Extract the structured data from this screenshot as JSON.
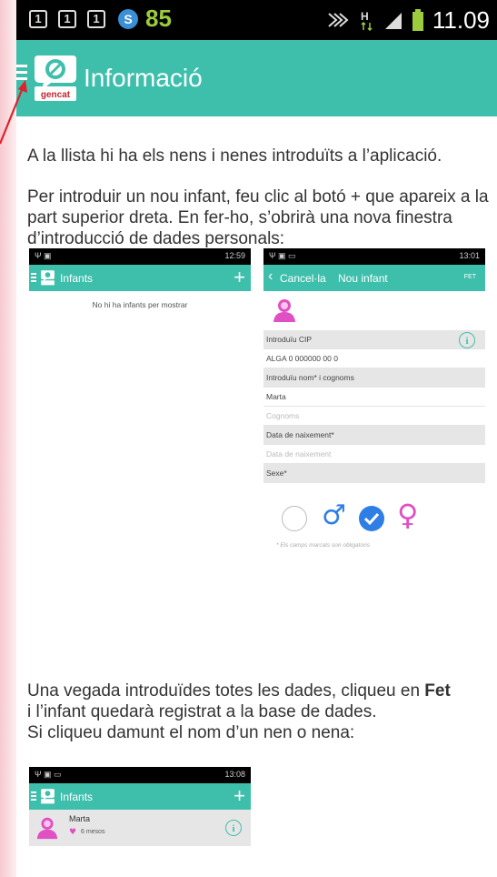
{
  "status_bar": {
    "notification_icons": [
      "1",
      "1",
      "1"
    ],
    "s_icon": "S",
    "battery_level": "85",
    "time": "11.09"
  },
  "app_bar": {
    "title": "Informació",
    "logo_text": "gencat"
  },
  "intro": {
    "p1": "A la llista hi ha els nens i nenes introduïts a l’aplicació.",
    "p2": "Per introduir un nou infant, feu clic al botó + que apareix a la part superior dreta. En fer-ho, s’obrirà una nova finestra d’introducció de dades personals:"
  },
  "shot1": {
    "status_time": "12:59",
    "title": "Infants",
    "plus": "+",
    "empty_message": "No hi ha infants per mostrar"
  },
  "shot2": {
    "status_time": "13:01",
    "cancel_label": "Cancel·la",
    "title": "Nou infant",
    "done_label": "FET",
    "cip_label": "Introduïu CIP",
    "cip_value": "ALGA 0 000000 00 0",
    "name_label": "Introduïu nom* i cognoms",
    "name_value": "Marta",
    "surname_placeholder": "Cognoms",
    "dob_label": "Data de naixement*",
    "dob_placeholder": "Data de naixement",
    "sex_label": "Sexe*",
    "male_symbol": "♂",
    "female_symbol": "♀",
    "footnote": "* Els camps marcats son obligatoris"
  },
  "outro": {
    "line1_a": "Una vegada introduïdes totes les dades, cliqueu en ",
    "line1_bold": "Fet",
    "line2": "i l’infant quedarà registrat a la base de dades.",
    "line3": "Si cliqueu damunt el nom d’un nen o nena:"
  },
  "shot3": {
    "status_time": "13:08",
    "title": "Infants",
    "plus": "+",
    "child_name": "Marta",
    "child_age": "6 mesos"
  },
  "colors": {
    "teal": "#3ebfac",
    "pink": "#e04fc4",
    "blue": "#2f7ee6",
    "arrow_red": "#e0202a"
  }
}
